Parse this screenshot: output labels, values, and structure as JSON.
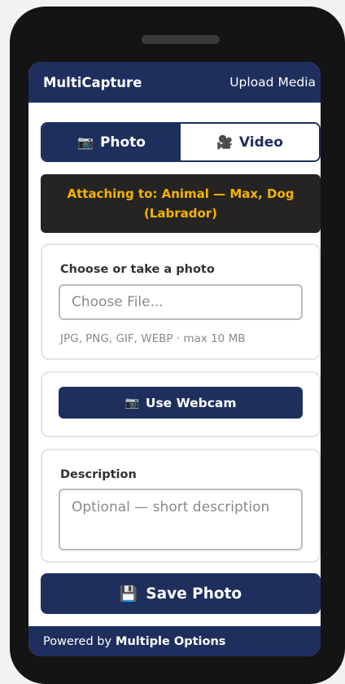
{
  "header": {
    "title": "MultiCapture",
    "subtitle": "Upload Media"
  },
  "tabs": [
    {
      "label": "Photo",
      "icon": "camera-icon",
      "glyph": "📷",
      "active": true
    },
    {
      "label": "Video",
      "icon": "video-camera-icon",
      "glyph": "🎥",
      "active": false
    }
  ],
  "attach_banner": {
    "text": "Attaching to: Animal — Max, Dog (Labrador)"
  },
  "file_card": {
    "label": "Choose or take a photo",
    "input_text": "Choose File...",
    "hint": "JPG, PNG, GIF, WEBP · max 10 MB"
  },
  "webcam": {
    "label": "Use Webcam",
    "icon": "camera-icon",
    "glyph": "📷"
  },
  "description": {
    "label": "Description",
    "placeholder": "Optional — short description"
  },
  "save": {
    "label": "Save Photo",
    "icon": "floppy-disk-icon",
    "glyph": "💾"
  },
  "footer": {
    "prefix": "Powered by",
    "brand": "Multiple Options"
  },
  "colors": {
    "primary": "#1e2f5e",
    "banner_bg": "#252422",
    "banner_text": "#f4b400",
    "device": "#141414"
  }
}
